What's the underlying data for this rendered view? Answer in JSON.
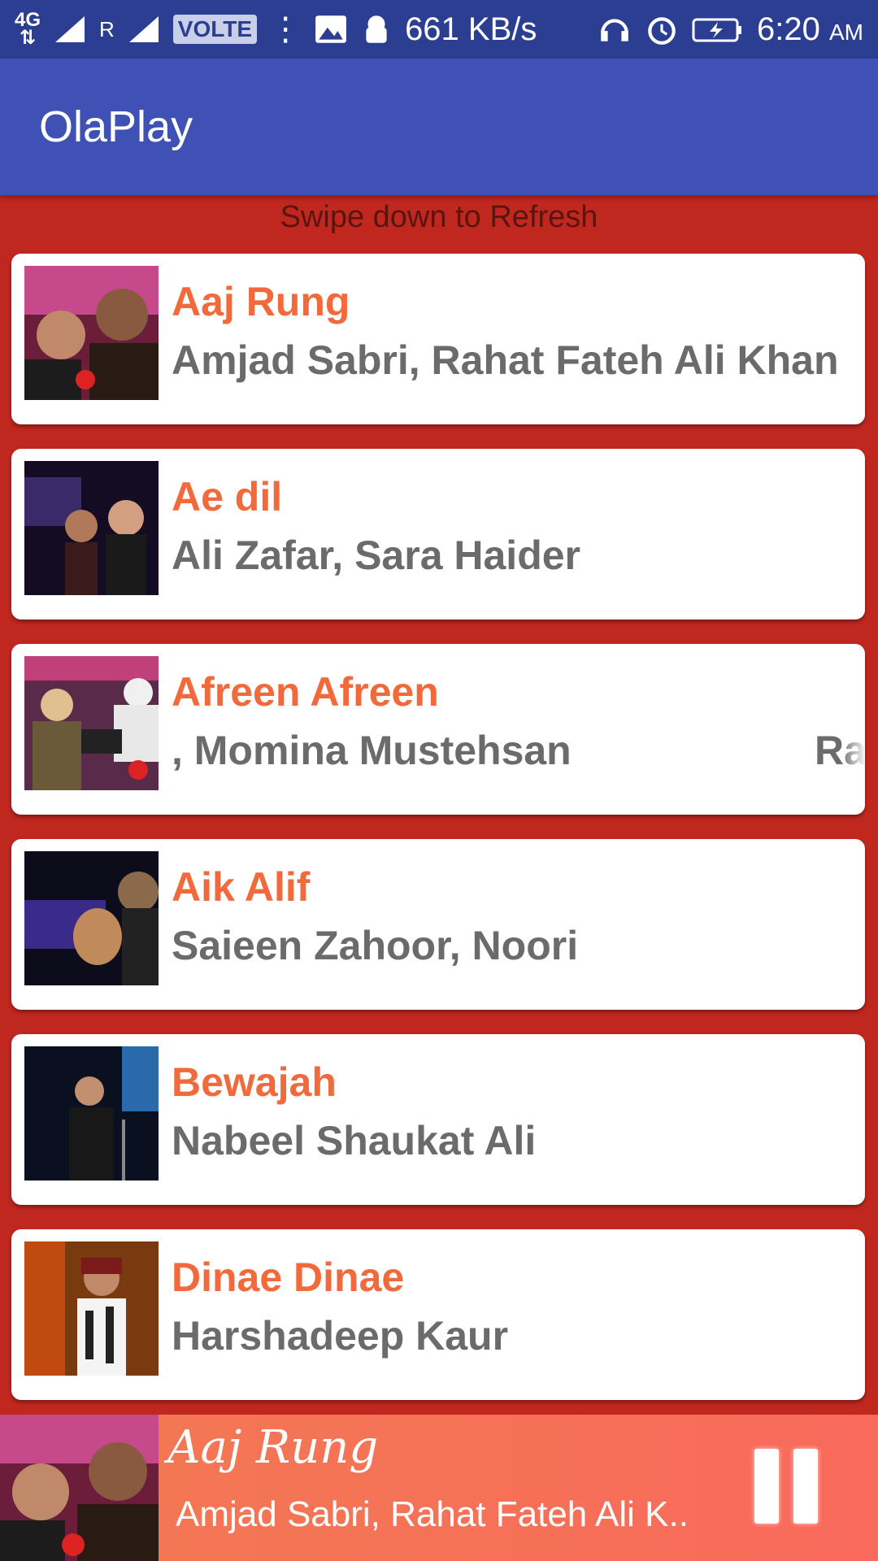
{
  "status_bar": {
    "network": "4G",
    "sim1": "R",
    "volte": "VOLTE",
    "speed": "661 KB/s",
    "time": "6:20",
    "ampm": "AM",
    "icons": [
      "gallery-icon",
      "android-debug-icon",
      "hifi-headphones-icon",
      "alarm-icon",
      "battery-charging-icon"
    ]
  },
  "app_bar": {
    "title": "OlaPlay"
  },
  "hint": "Swipe down to Refresh",
  "songs": [
    {
      "title": "Aaj Rung",
      "artists": "Amjad Sabri,  Rahat Fateh Ali Khan"
    },
    {
      "title": "Ae dil",
      "artists": "Ali Zafar, Sara Haider"
    },
    {
      "title": "Afreen Afreen",
      "artists": ", Momina Mustehsan",
      "artists_tail": "Ra"
    },
    {
      "title": "Aik Alif",
      "artists": "Saieen Zahoor, Noori"
    },
    {
      "title": "Bewajah",
      "artists": "Nabeel Shaukat Ali"
    },
    {
      "title": "Dinae Dinae",
      "artists": "Harshadeep Kaur"
    }
  ],
  "now_playing": {
    "title": "Aaj Rung",
    "artists": "Amjad Sabri,  Rahat Fateh Ali K..",
    "control": "pause-icon"
  },
  "colors": {
    "status_bar": "#2c3e92",
    "app_bar": "#3f51b5",
    "background": "#c0271f",
    "title": "#f26a3c",
    "artist": "#6b6b6b"
  }
}
